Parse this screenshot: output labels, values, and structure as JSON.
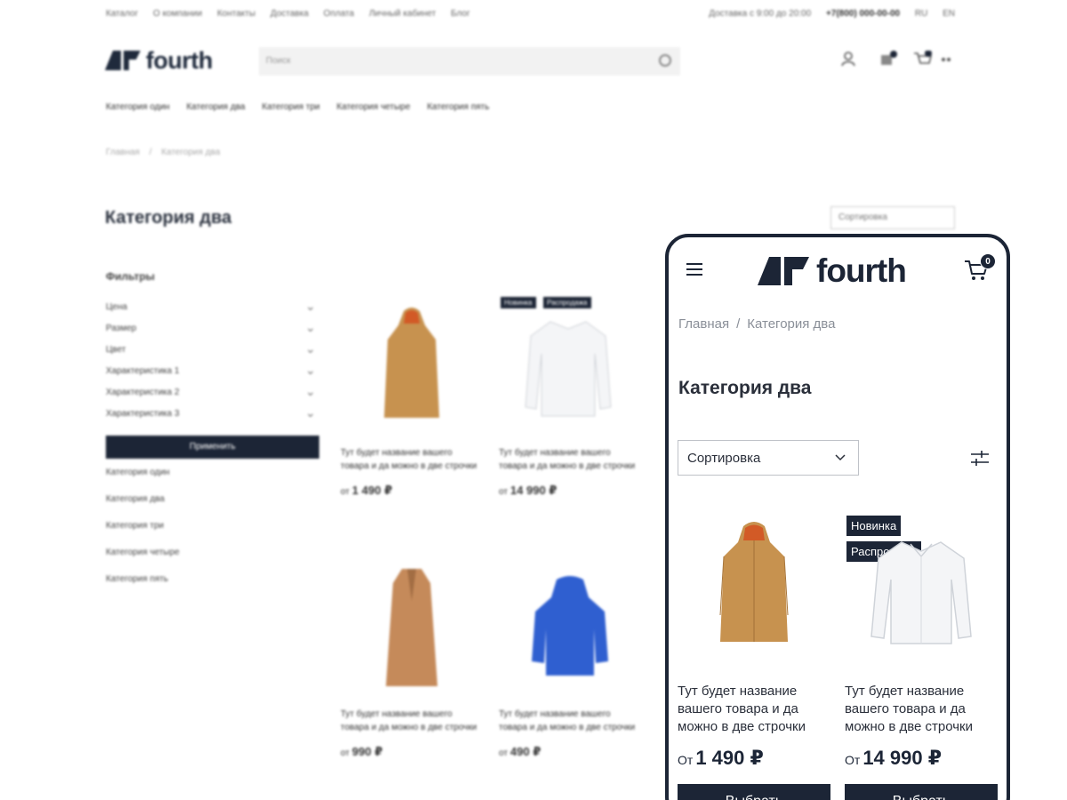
{
  "brand": {
    "name": "fourth",
    "dark": "#1c2536",
    "accent_coat": "#c7924f",
    "accent_hoodie": "#2f5fd0"
  },
  "desktop": {
    "topbar": {
      "links": [
        "Каталог",
        "О компании",
        "Контакты",
        "Доставка",
        "Оплата",
        "Личный кабинет",
        "Блог"
      ],
      "delivery": "Доставка с 9:00 до 20:00",
      "phone": "+7(800) 000-00-00",
      "langs": [
        "RU",
        "EN"
      ]
    },
    "search_placeholder": "Поиск",
    "category_nav": [
      "Категория один",
      "Категория два",
      "Категория три",
      "Категория четыре",
      "Категория пять"
    ],
    "breadcrumb": [
      "Главная",
      "Категория два"
    ],
    "title": "Категория два",
    "sort_label": "Сортировка",
    "filters": {
      "heading": "Фильтры",
      "rows": [
        "Цена",
        "Размер",
        "Цвет",
        "Характеристика 1",
        "Характеристика 2",
        "Характеристика 3"
      ],
      "apply_label": "Применить",
      "categories": [
        "Категория один",
        "Категория два",
        "Категория три",
        "Категория четыре",
        "Категория пять"
      ]
    },
    "products": [
      {
        "name": "Тут будет название вашего товара и да можно в две строчки",
        "from": "от",
        "price": "1 490 ₽",
        "icon": "raincoat-icon",
        "badges": []
      },
      {
        "name": "Тут будет название вашего товара и да можно в две строчки",
        "from": "от",
        "price": "14 990 ₽",
        "icon": "shirt-icon",
        "badges": [
          "Новинка",
          "Распродажа"
        ]
      },
      {
        "name": "Тут будет название вашего товара и да можно в две строчки",
        "from": "от",
        "price": "990 ₽",
        "icon": "coat-icon",
        "badges": []
      },
      {
        "name": "Тут будет название вашего товара и да можно в две строчки",
        "from": "от",
        "price": "490 ₽",
        "icon": "hoodie-icon",
        "badges": []
      }
    ]
  },
  "mobile": {
    "cart_count": "0",
    "breadcrumb": {
      "home": "Главная",
      "current": "Категория два",
      "separator": "/"
    },
    "title": "Категория два",
    "sort_label": "Сортировка",
    "products": [
      {
        "name": "Тут будет название вашего товара и да можно в две строчки",
        "from": "От",
        "price": "1 490 ₽",
        "button": "Выбрать",
        "icon": "raincoat-icon",
        "badges": []
      },
      {
        "name": "Тут будет название вашего товара и да можно в две строчки",
        "from": "От",
        "price": "14 990 ₽",
        "button": "Выбрать",
        "icon": "shirt-icon",
        "badges": [
          "Новинка",
          "Распродажа"
        ]
      }
    ]
  }
}
